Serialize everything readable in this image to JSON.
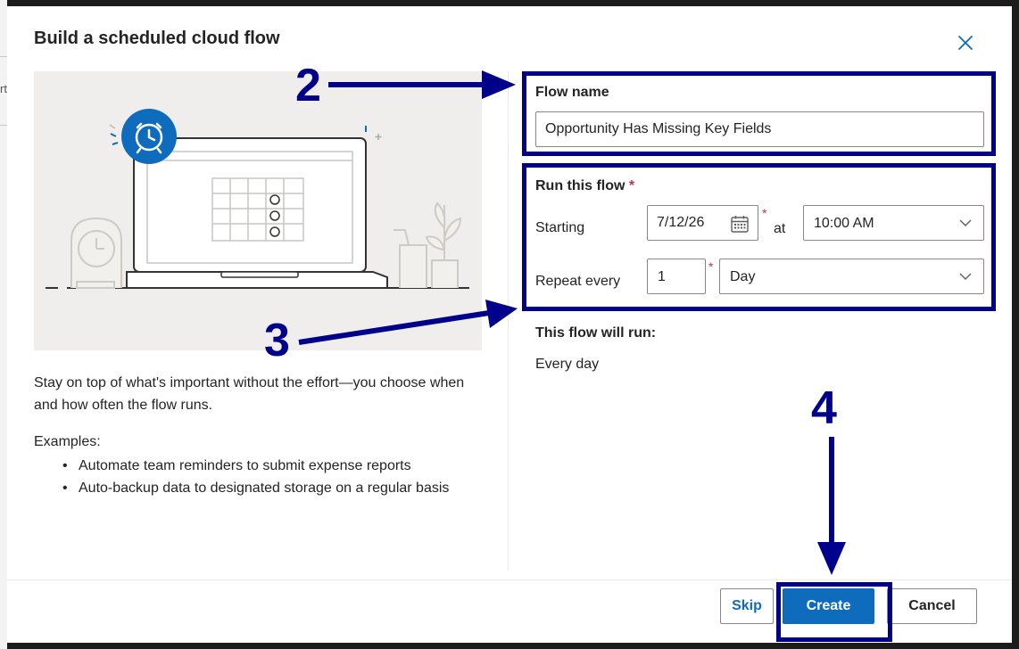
{
  "backdrop": {
    "partial_char": "rt"
  },
  "dialog": {
    "title": "Build a scheduled cloud flow",
    "close_icon": "close-icon"
  },
  "left": {
    "illustration": "laptop-with-alarm-clock-illustration",
    "description": "Stay on top of what's important without the effort—you choose when and how often the flow runs.",
    "examples_label": "Examples:",
    "examples": [
      "Automate team reminders to submit expense reports",
      "Auto-backup data to designated storage on a regular basis"
    ]
  },
  "form": {
    "flow_name_label": "Flow name",
    "flow_name_value": "Opportunity Has Missing Key Fields",
    "run_label": "Run this flow",
    "required_mark": "*",
    "starting_label": "Starting",
    "start_date": "7/12/26",
    "calendar_icon": "calendar-icon",
    "at_label": "at",
    "start_time": "10:00 AM",
    "repeat_label": "Repeat every",
    "repeat_interval": "1",
    "repeat_unit": "Day",
    "will_run_label": "This flow will run:",
    "will_run_value": "Every day"
  },
  "buttons": {
    "skip": "Skip",
    "create": "Create",
    "cancel": "Cancel"
  },
  "annotations": {
    "step_2": "2",
    "step_3": "3",
    "step_4": "4",
    "color": "#00008b"
  },
  "colors": {
    "primary": "#0f6cbd",
    "required": "#c4314b",
    "illustration_bg": "#efeeec",
    "alarm_blue": "#0f6cbd"
  }
}
